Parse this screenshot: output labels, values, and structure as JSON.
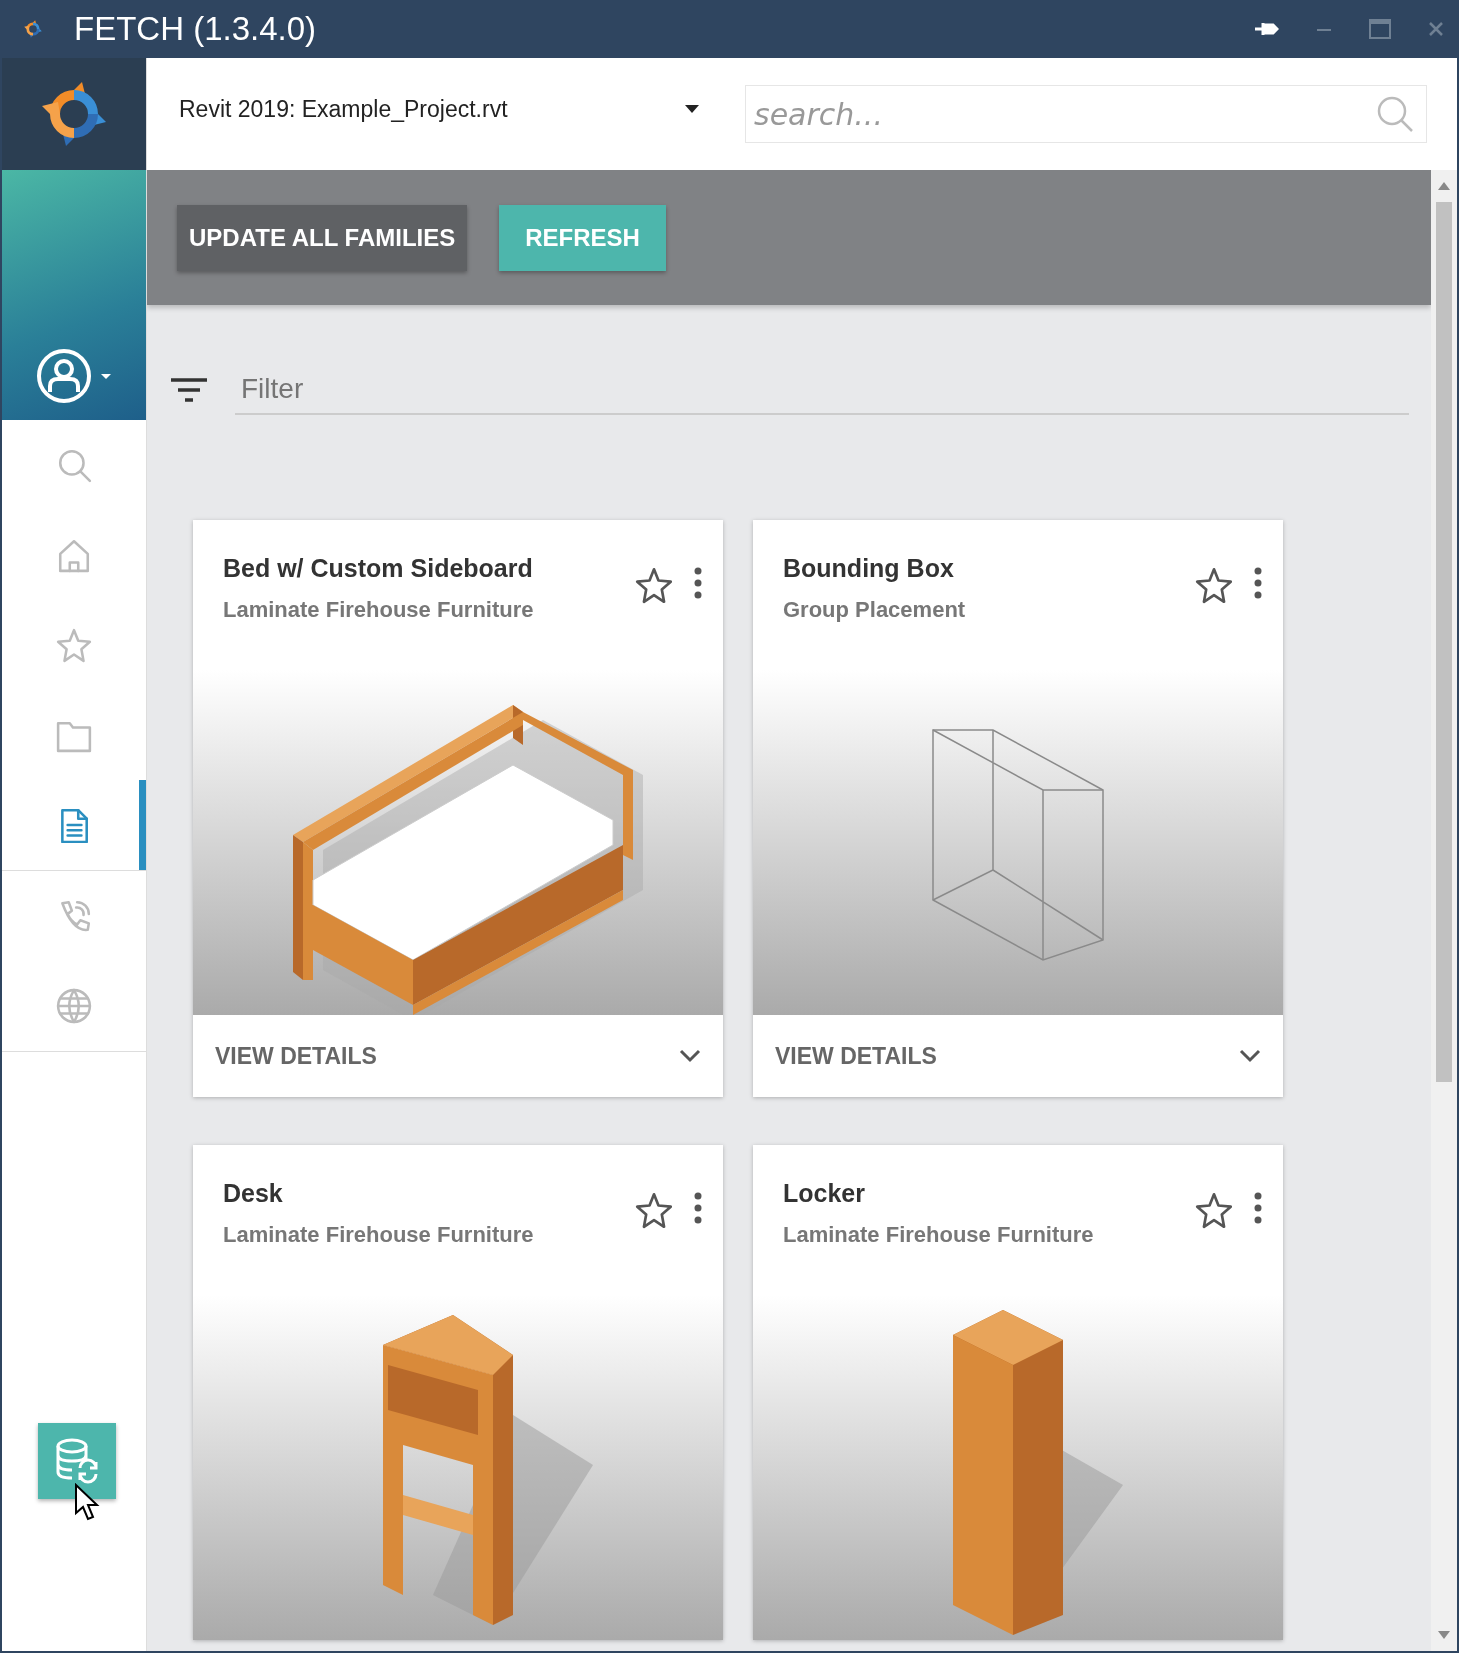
{
  "window": {
    "title": "FETCH (1.3.4.0)"
  },
  "sidebar": {
    "items": [
      {
        "kind": "search",
        "selected": false
      },
      {
        "kind": "home",
        "selected": false
      },
      {
        "kind": "star",
        "selected": false
      },
      {
        "kind": "folder",
        "selected": false
      },
      {
        "kind": "document",
        "selected": true
      },
      {
        "kind": "phone",
        "selected": false
      },
      {
        "kind": "globe",
        "selected": false
      }
    ]
  },
  "project_selector": {
    "value": "Revit 2019: Example_Project.rvt"
  },
  "search": {
    "placeholder": "search..."
  },
  "toolbar": {
    "buttons": [
      {
        "label": "UPDATE ALL FAMILIES",
        "kind": "dark"
      },
      {
        "label": "REFRESH",
        "kind": "accent"
      }
    ]
  },
  "filter": {
    "placeholder": "Filter"
  },
  "cards": [
    {
      "title": "Bed w/ Custom Sideboard",
      "subtitle": "Laminate Firehouse Furniture",
      "favorite": false,
      "kind": "bed",
      "action": "VIEW DETAILS"
    },
    {
      "title": "Bounding Box",
      "subtitle": "Group Placement",
      "favorite": false,
      "kind": "box",
      "action": "VIEW DETAILS"
    },
    {
      "title": "Desk",
      "subtitle": "Laminate Firehouse Furniture",
      "favorite": false,
      "kind": "desk"
    },
    {
      "title": "Locker",
      "subtitle": "Laminate Firehouse Furniture",
      "favorite": false,
      "kind": "locker"
    }
  ]
}
